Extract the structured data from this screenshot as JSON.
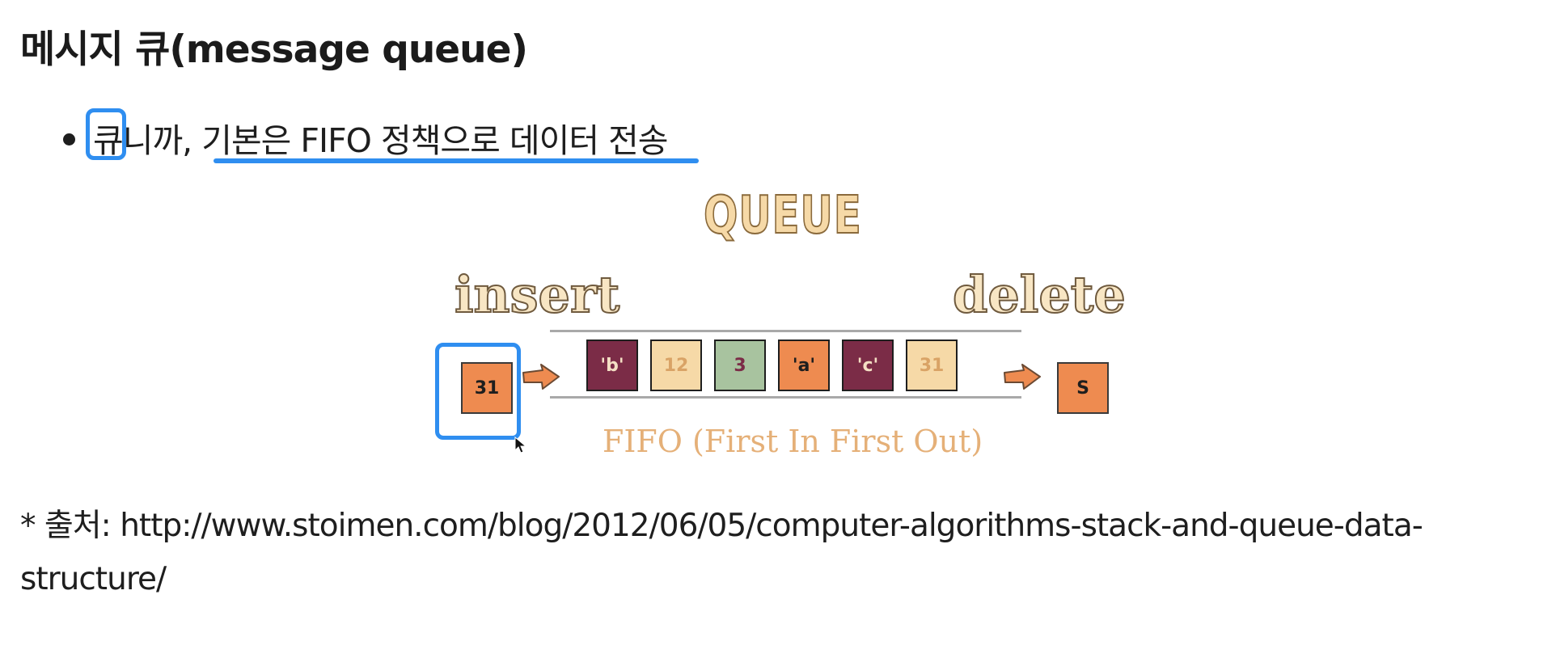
{
  "heading": "메시지 큐(message queue)",
  "bullet": {
    "text": "큐니까, 기본은 FIFO 정책으로 데이터 전송"
  },
  "diagram": {
    "title": "QUEUE",
    "insert_label": "insert",
    "delete_label": "delete",
    "incoming_value": "31",
    "outgoing_value": "S",
    "queue": [
      {
        "label": "'b'",
        "bg": "#7b2c47",
        "fg": "#f4dfc4"
      },
      {
        "label": "12",
        "bg": "#f6d9a7",
        "fg": "#d9a366"
      },
      {
        "label": "3",
        "bg": "#a8c39f",
        "fg": "#7b2c47"
      },
      {
        "label": "'a'",
        "bg": "#ee8b50",
        "fg": "#1e1e1e"
      },
      {
        "label": "'c'",
        "bg": "#7b2c47",
        "fg": "#f4dfc4"
      },
      {
        "label": "31",
        "bg": "#f6d9a7",
        "fg": "#d9a366"
      }
    ],
    "caption": "FIFO (First In First Out)"
  },
  "source": "* 출처: http://www.stoimen.com/blog/2012/06/05/computer-algorithms-stack-and-queue-data-structure/",
  "colors": {
    "highlight": "#2f8ef0",
    "orange": "#ee8b50",
    "plum": "#7b2c47",
    "cream": "#f6d9a7",
    "sage": "#a8c39f"
  }
}
